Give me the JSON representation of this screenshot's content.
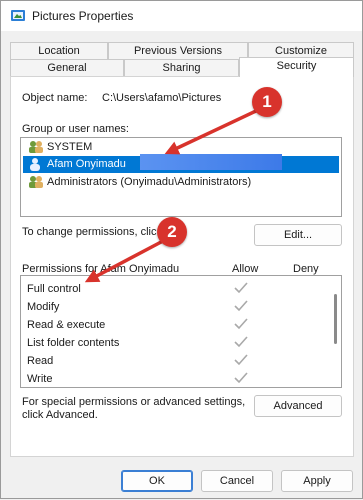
{
  "window": {
    "title": "Pictures Properties"
  },
  "tabs_back": [
    "Location",
    "Previous Versions",
    "Customize"
  ],
  "tabs_front": [
    "General",
    "Sharing",
    "Security"
  ],
  "object": {
    "label": "Object name:",
    "value": "C:\\Users\\afamo\\Pictures"
  },
  "groups": {
    "label": "Group or user names:",
    "items": [
      "SYSTEM",
      "Afam Onyimadu",
      "Administrators (Onyimadu\\Administrators)"
    ]
  },
  "change": {
    "text": "To change permissions, clic",
    "edit_label": "Edit..."
  },
  "permissions": {
    "for_label": "Permissions for Afam Onyimadu",
    "allow_label": "Allow",
    "deny_label": "Deny",
    "rows": [
      "Full control",
      "Modify",
      "Read & execute",
      "List folder contents",
      "Read",
      "Write"
    ]
  },
  "special": {
    "text_line1": "For special permissions or advanced settings,",
    "text_line2": "click Advanced.",
    "advanced_label": "Advanced"
  },
  "buttons": {
    "ok": "OK",
    "cancel": "Cancel",
    "apply": "Apply"
  },
  "annotations": [
    "1",
    "2"
  ],
  "colors": {
    "selection": "#0078d4",
    "annotation": "#d8332c"
  }
}
